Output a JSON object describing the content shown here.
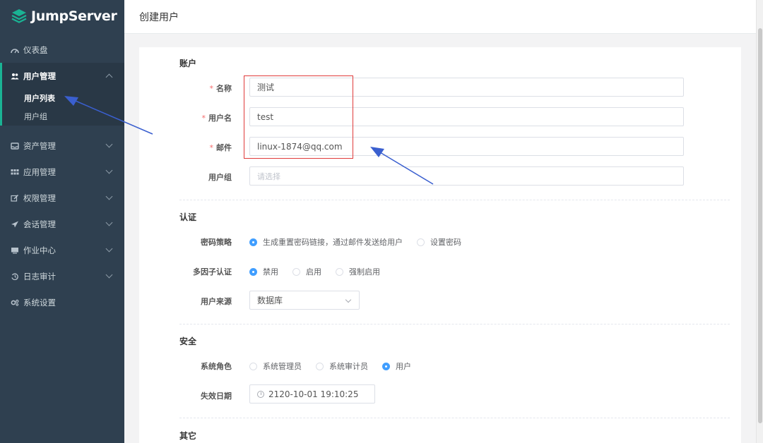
{
  "app": {
    "name": "JumpServer"
  },
  "sidebar": {
    "items": [
      {
        "label": "仪表盘",
        "icon": "dashboard-icon"
      },
      {
        "label": "用户管理",
        "icon": "users-icon",
        "expanded": true,
        "children": [
          {
            "label": "用户列表",
            "active": true
          },
          {
            "label": "用户组"
          }
        ]
      },
      {
        "label": "资产管理",
        "icon": "inbox-icon"
      },
      {
        "label": "应用管理",
        "icon": "grid-icon"
      },
      {
        "label": "权限管理",
        "icon": "edit-icon"
      },
      {
        "label": "会话管理",
        "icon": "rocket-icon"
      },
      {
        "label": "作业中心",
        "icon": "terminal-icon"
      },
      {
        "label": "日志审计",
        "icon": "history-icon"
      },
      {
        "label": "系统设置",
        "icon": "gears-icon"
      }
    ]
  },
  "header": {
    "title": "创建用户"
  },
  "form": {
    "account": {
      "title": "账户",
      "name": {
        "label": "名称",
        "value": "测试",
        "required": true
      },
      "username": {
        "label": "用户名",
        "value": "test",
        "required": true
      },
      "email": {
        "label": "邮件",
        "value": "linux-1874@qq.com",
        "required": true
      },
      "groups": {
        "label": "用户组",
        "placeholder": "请选择"
      }
    },
    "auth": {
      "title": "认证",
      "password_strategy": {
        "label": "密码策略",
        "options": [
          "生成重置密码链接，通过邮件发送给用户",
          "设置密码"
        ],
        "selected": 0
      },
      "mfa": {
        "label": "多因子认证",
        "options": [
          "禁用",
          "启用",
          "强制启用"
        ],
        "selected": 0
      },
      "source": {
        "label": "用户来源",
        "value": "数据库"
      }
    },
    "security": {
      "title": "安全",
      "role": {
        "label": "系统角色",
        "options": [
          "系统管理员",
          "系统审计员",
          "用户"
        ],
        "selected": 2
      },
      "expire": {
        "label": "失效日期",
        "value": "2120-10-01 19:10:25"
      }
    },
    "other": {
      "title": "其它"
    }
  },
  "colors": {
    "sidebar_bg": "#2f4050",
    "accent_green": "#1ab394",
    "primary_blue": "#409eff",
    "required_red": "#f56c6c",
    "annotation_red": "#e03a3a",
    "annotation_arrow": "#3a5fcf"
  }
}
